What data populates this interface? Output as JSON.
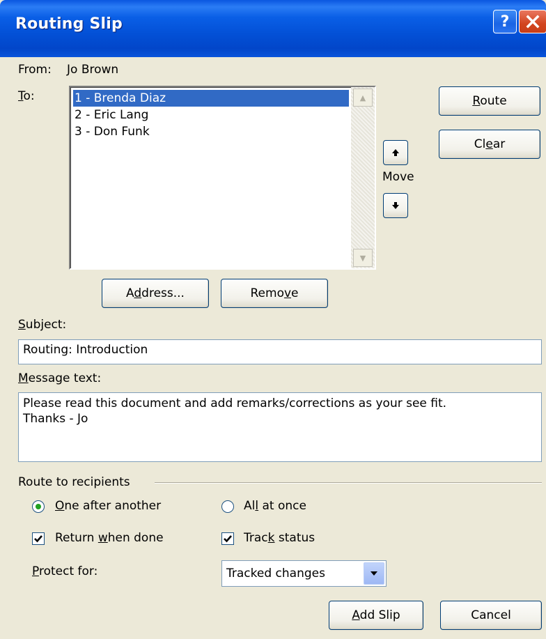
{
  "window": {
    "title": "Routing Slip"
  },
  "from": {
    "label": "From:",
    "value": "Jo Brown"
  },
  "to": {
    "label_prefix": "",
    "label_underlined": "T",
    "label_suffix": "o:",
    "recipients": [
      "1 - Brenda Diaz",
      "2 - Eric Lang",
      "3 - Don Funk"
    ],
    "selected_index": 0
  },
  "buttons": {
    "route": {
      "mn": "R",
      "rest": "oute"
    },
    "clear": {
      "pre": "Cl",
      "mn": "e",
      "rest": "ar"
    },
    "address": {
      "pre": "A",
      "mn": "d",
      "rest": "dress..."
    },
    "remove": {
      "pre": "Remo",
      "mn": "v",
      "rest": "e"
    },
    "add_slip": {
      "mn": "A",
      "rest": "dd Slip"
    },
    "cancel": "Cancel"
  },
  "move": {
    "label": "Move",
    "up_icon": "up-arrow-icon",
    "down_icon": "down-arrow-icon"
  },
  "subject": {
    "label_mn": "S",
    "label_rest": "ubject:",
    "value": "Routing: Introduction"
  },
  "message": {
    "label_mn": "M",
    "label_rest": "essage text:",
    "value": "Please read this document and add remarks/corrections as your see fit.\nThanks - Jo"
  },
  "route_to_recipients": {
    "group_label": "Route to recipients",
    "one_after_another": {
      "mn": "O",
      "rest": "ne after another",
      "checked": true
    },
    "all_at_once": {
      "pre": "Al",
      "mn": "l",
      "rest": " at once",
      "checked": false
    }
  },
  "return_when_done": {
    "pre": "Return ",
    "mn": "w",
    "rest": "hen done",
    "checked": true
  },
  "track_status": {
    "pre": "Trac",
    "mn": "k",
    "rest": " status",
    "checked": true
  },
  "protect_for": {
    "label_mn": "P",
    "label_rest": "rotect for:",
    "value": "Tracked changes"
  },
  "colors": {
    "selection": "#316ac5",
    "title_blue": "#0350d6",
    "dialog_bg": "#ece9d8"
  }
}
